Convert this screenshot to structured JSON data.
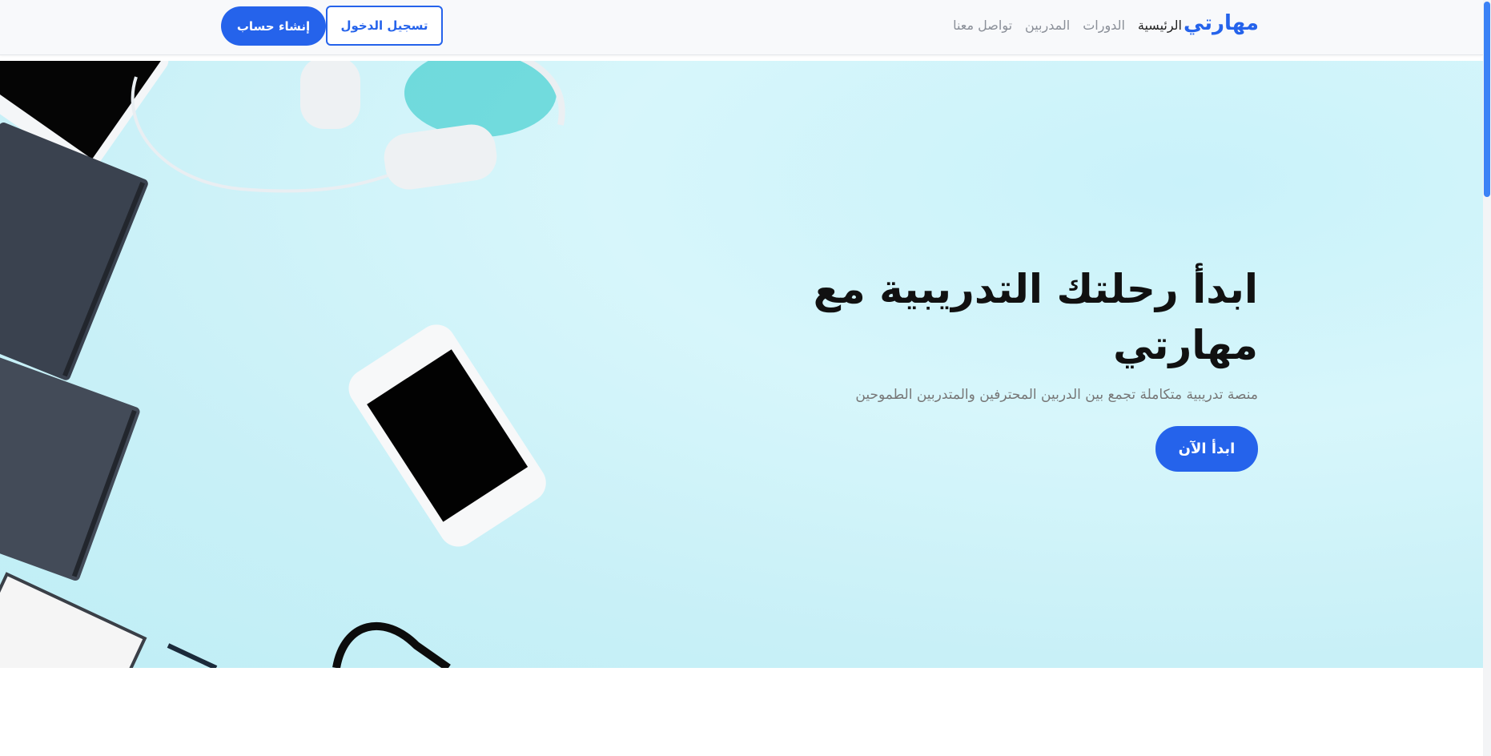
{
  "navbar": {
    "brand": "مهارتي",
    "links": [
      "الرئيسية",
      "الدورات",
      "المدربين",
      "تواصل معنا"
    ],
    "login_label": "تسجيل الدخول",
    "signup_label": "إنشاء حساب"
  },
  "hero": {
    "title": "ابدأ رحلتك التدريبية مع مهارتي",
    "subtitle": "منصة تدريبية متكاملة تجمع بين الدربين المحترفين والمتدربين الطموحين",
    "cta_label": "ابدأ الآن"
  },
  "colors": {
    "accent": "#2563eb",
    "hero_bg": "#cdf3fa"
  }
}
